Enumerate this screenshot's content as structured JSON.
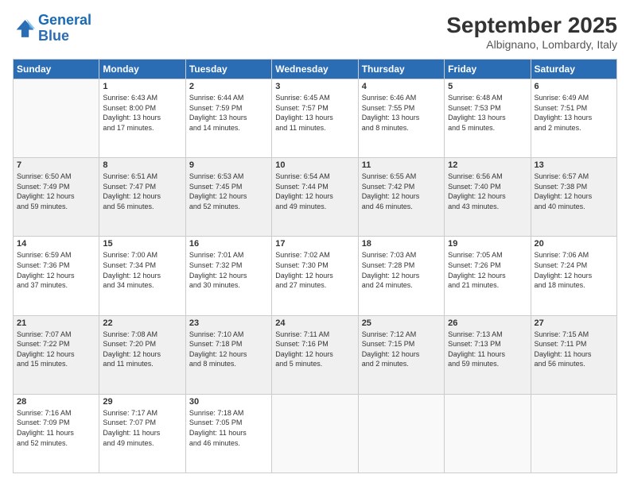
{
  "logo": {
    "line1": "General",
    "line2": "Blue"
  },
  "header": {
    "month_year": "September 2025",
    "location": "Albignano, Lombardy, Italy"
  },
  "weekdays": [
    "Sunday",
    "Monday",
    "Tuesday",
    "Wednesday",
    "Thursday",
    "Friday",
    "Saturday"
  ],
  "weeks": [
    [
      {
        "day": "",
        "info": ""
      },
      {
        "day": "1",
        "info": "Sunrise: 6:43 AM\nSunset: 8:00 PM\nDaylight: 13 hours\nand 17 minutes."
      },
      {
        "day": "2",
        "info": "Sunrise: 6:44 AM\nSunset: 7:59 PM\nDaylight: 13 hours\nand 14 minutes."
      },
      {
        "day": "3",
        "info": "Sunrise: 6:45 AM\nSunset: 7:57 PM\nDaylight: 13 hours\nand 11 minutes."
      },
      {
        "day": "4",
        "info": "Sunrise: 6:46 AM\nSunset: 7:55 PM\nDaylight: 13 hours\nand 8 minutes."
      },
      {
        "day": "5",
        "info": "Sunrise: 6:48 AM\nSunset: 7:53 PM\nDaylight: 13 hours\nand 5 minutes."
      },
      {
        "day": "6",
        "info": "Sunrise: 6:49 AM\nSunset: 7:51 PM\nDaylight: 13 hours\nand 2 minutes."
      }
    ],
    [
      {
        "day": "7",
        "info": "Sunrise: 6:50 AM\nSunset: 7:49 PM\nDaylight: 12 hours\nand 59 minutes."
      },
      {
        "day": "8",
        "info": "Sunrise: 6:51 AM\nSunset: 7:47 PM\nDaylight: 12 hours\nand 56 minutes."
      },
      {
        "day": "9",
        "info": "Sunrise: 6:53 AM\nSunset: 7:45 PM\nDaylight: 12 hours\nand 52 minutes."
      },
      {
        "day": "10",
        "info": "Sunrise: 6:54 AM\nSunset: 7:44 PM\nDaylight: 12 hours\nand 49 minutes."
      },
      {
        "day": "11",
        "info": "Sunrise: 6:55 AM\nSunset: 7:42 PM\nDaylight: 12 hours\nand 46 minutes."
      },
      {
        "day": "12",
        "info": "Sunrise: 6:56 AM\nSunset: 7:40 PM\nDaylight: 12 hours\nand 43 minutes."
      },
      {
        "day": "13",
        "info": "Sunrise: 6:57 AM\nSunset: 7:38 PM\nDaylight: 12 hours\nand 40 minutes."
      }
    ],
    [
      {
        "day": "14",
        "info": "Sunrise: 6:59 AM\nSunset: 7:36 PM\nDaylight: 12 hours\nand 37 minutes."
      },
      {
        "day": "15",
        "info": "Sunrise: 7:00 AM\nSunset: 7:34 PM\nDaylight: 12 hours\nand 34 minutes."
      },
      {
        "day": "16",
        "info": "Sunrise: 7:01 AM\nSunset: 7:32 PM\nDaylight: 12 hours\nand 30 minutes."
      },
      {
        "day": "17",
        "info": "Sunrise: 7:02 AM\nSunset: 7:30 PM\nDaylight: 12 hours\nand 27 minutes."
      },
      {
        "day": "18",
        "info": "Sunrise: 7:03 AM\nSunset: 7:28 PM\nDaylight: 12 hours\nand 24 minutes."
      },
      {
        "day": "19",
        "info": "Sunrise: 7:05 AM\nSunset: 7:26 PM\nDaylight: 12 hours\nand 21 minutes."
      },
      {
        "day": "20",
        "info": "Sunrise: 7:06 AM\nSunset: 7:24 PM\nDaylight: 12 hours\nand 18 minutes."
      }
    ],
    [
      {
        "day": "21",
        "info": "Sunrise: 7:07 AM\nSunset: 7:22 PM\nDaylight: 12 hours\nand 15 minutes."
      },
      {
        "day": "22",
        "info": "Sunrise: 7:08 AM\nSunset: 7:20 PM\nDaylight: 12 hours\nand 11 minutes."
      },
      {
        "day": "23",
        "info": "Sunrise: 7:10 AM\nSunset: 7:18 PM\nDaylight: 12 hours\nand 8 minutes."
      },
      {
        "day": "24",
        "info": "Sunrise: 7:11 AM\nSunset: 7:16 PM\nDaylight: 12 hours\nand 5 minutes."
      },
      {
        "day": "25",
        "info": "Sunrise: 7:12 AM\nSunset: 7:15 PM\nDaylight: 12 hours\nand 2 minutes."
      },
      {
        "day": "26",
        "info": "Sunrise: 7:13 AM\nSunset: 7:13 PM\nDaylight: 11 hours\nand 59 minutes."
      },
      {
        "day": "27",
        "info": "Sunrise: 7:15 AM\nSunset: 7:11 PM\nDaylight: 11 hours\nand 56 minutes."
      }
    ],
    [
      {
        "day": "28",
        "info": "Sunrise: 7:16 AM\nSunset: 7:09 PM\nDaylight: 11 hours\nand 52 minutes."
      },
      {
        "day": "29",
        "info": "Sunrise: 7:17 AM\nSunset: 7:07 PM\nDaylight: 11 hours\nand 49 minutes."
      },
      {
        "day": "30",
        "info": "Sunrise: 7:18 AM\nSunset: 7:05 PM\nDaylight: 11 hours\nand 46 minutes."
      },
      {
        "day": "",
        "info": ""
      },
      {
        "day": "",
        "info": ""
      },
      {
        "day": "",
        "info": ""
      },
      {
        "day": "",
        "info": ""
      }
    ]
  ]
}
